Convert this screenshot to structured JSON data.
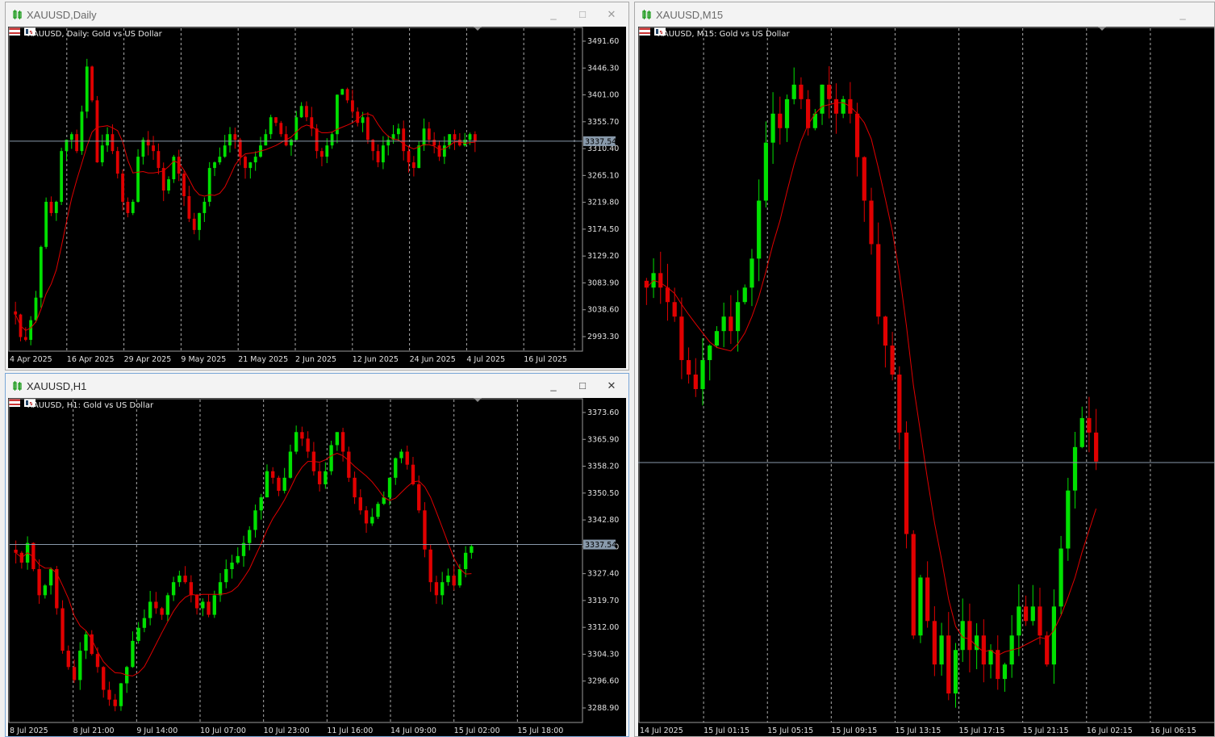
{
  "windows": [
    {
      "id": "daily",
      "title": "XAUUSD,Daily",
      "symbol_desc": "XAUUSD, Daily:  Gold vs US Dollar",
      "active": false,
      "controls": {
        "minimize": "_",
        "maximize": "□",
        "close": "✕"
      },
      "current_price": "3337.54",
      "price_axis": [
        "3491.60",
        "3446.30",
        "3401.00",
        "3355.70",
        "3310.40",
        "3265.10",
        "3219.80",
        "3174.50",
        "3129.20",
        "3083.90",
        "3038.60",
        "2993.30"
      ],
      "price_range": [
        2965,
        3515
      ],
      "time_axis": [
        "4 Apr 2025",
        "16 Apr 2025",
        "29 Apr 2025",
        "9 May 2025",
        "21 May 2025",
        "2 Jun 2025",
        "12 Jun 2025",
        "24 Jun 2025",
        "4 Jul 2025",
        "16 Jul 2025"
      ],
      "colors": {
        "up": "#00e000",
        "down": "#e00000",
        "ma": "#e00000",
        "grid": "#c8c8c8",
        "price_line": "#8899aa"
      }
    },
    {
      "id": "h1",
      "title": "XAUUSD,H1",
      "symbol_desc": "XAUUSD, H1:  Gold vs US Dollar",
      "active": true,
      "controls": {
        "minimize": "_",
        "maximize": "□",
        "close": "✕"
      },
      "current_price": "3337.54",
      "price_axis": [
        "3373.60",
        "3365.90",
        "3358.20",
        "3350.50",
        "3342.80",
        "3335.10",
        "3327.40",
        "3319.70",
        "3312.00",
        "3304.30",
        "3296.60",
        "3288.90"
      ],
      "price_range": [
        3283,
        3378
      ],
      "time_axis": [
        "8 Jul 2025",
        "8 Jul 21:00",
        "9 Jul 14:00",
        "10 Jul 07:00",
        "10 Jul 23:00",
        "11 Jul 16:00",
        "14 Jul 09:00",
        "15 Jul 02:00",
        "15 Jul 18:00"
      ],
      "colors": {
        "up": "#00e000",
        "down": "#e00000",
        "ma": "#e00000",
        "grid": "#c8c8c8",
        "price_line": "#8899aa"
      }
    },
    {
      "id": "m15",
      "title": "XAUUSD,M15",
      "symbol_desc": "XAUUSD, M15:  Gold vs US Dollar",
      "active": false,
      "controls": {
        "minimize": "_",
        "maximize": "□",
        "close": "✕"
      },
      "time_axis": [
        "14 Jul 2025",
        "15 Jul 01:15",
        "15 Jul 05:15",
        "15 Jul 09:15",
        "15 Jul 13:15",
        "15 Jul 17:15",
        "15 Jul 21:15",
        "16 Jul 02:15",
        "16 Jul 06:15"
      ],
      "price_range": [
        3320,
        3367
      ],
      "colors": {
        "up": "#00e000",
        "down": "#e00000",
        "ma": "#e00000",
        "grid": "#c8c8c8",
        "price_line": "#8899aa"
      }
    }
  ],
  "chart_data": [
    {
      "type": "candlestick",
      "title": "XAUUSD, Daily:  Gold vs US Dollar",
      "xlabel": "",
      "ylabel": "",
      "ylim": [
        2965,
        3515
      ],
      "current_price": 3337.54,
      "x": [
        "4 Apr 2025",
        "16 Apr 2025",
        "29 Apr 2025",
        "9 May 2025",
        "21 May 2025",
        "2 Jun 2025",
        "12 Jun 2025",
        "24 Jun 2025",
        "4 Jul 2025",
        "16 Jul 2025"
      ],
      "closes": [
        3030,
        2990,
        2985,
        3020,
        3060,
        3150,
        3230,
        3210,
        3230,
        3320,
        3340,
        3350,
        3320,
        3390,
        3470,
        3410,
        3300,
        3330,
        3350,
        3320,
        3280,
        3230,
        3210,
        3230,
        3310,
        3340,
        3330,
        3320,
        3290,
        3250,
        3270,
        3310,
        3280,
        3240,
        3200,
        3180,
        3210,
        3230,
        3290,
        3300,
        3310,
        3330,
        3350,
        3340,
        3310,
        3290,
        3300,
        3310,
        3330,
        3350,
        3380,
        3370,
        3350,
        3330,
        3340,
        3380,
        3400,
        3380,
        3360,
        3320,
        3310,
        3330,
        3350,
        3420,
        3430,
        3410,
        3390,
        3370,
        3380,
        3340,
        3320,
        3300,
        3330,
        3340,
        3350,
        3360,
        3320,
        3300,
        3290,
        3330,
        3360,
        3340,
        3330,
        3310,
        3330,
        3350,
        3340,
        3330,
        3340,
        3350,
        3337
      ],
      "moving_average_end": 3340,
      "grid": true
    },
    {
      "type": "candlestick",
      "title": "XAUUSD, H1:  Gold vs US Dollar",
      "xlabel": "",
      "ylabel": "",
      "ylim": [
        3283,
        3378
      ],
      "current_price": 3337.54,
      "x": [
        "8 Jul 2025",
        "8 Jul 21:00",
        "9 Jul 14:00",
        "10 Jul 07:00",
        "10 Jul 23:00",
        "11 Jul 16:00",
        "14 Jul 09:00",
        "15 Jul 02:00",
        "15 Jul 18:00"
      ],
      "closes": [
        3335,
        3332,
        3338,
        3330,
        3322,
        3325,
        3330,
        3318,
        3305,
        3300,
        3296,
        3305,
        3310,
        3304,
        3300,
        3293,
        3290,
        3288,
        3295,
        3300,
        3308,
        3312,
        3315,
        3320,
        3318,
        3316,
        3322,
        3326,
        3328,
        3326,
        3322,
        3318,
        3320,
        3316,
        3322,
        3326,
        3330,
        3332,
        3334,
        3338,
        3342,
        3348,
        3352,
        3360,
        3358,
        3354,
        3358,
        3366,
        3372,
        3370,
        3366,
        3360,
        3356,
        3360,
        3368,
        3372,
        3366,
        3358,
        3352,
        3348,
        3344,
        3346,
        3350,
        3352,
        3358,
        3364,
        3366,
        3362,
        3356,
        3348,
        3336,
        3326,
        3322,
        3326,
        3328,
        3325,
        3330,
        3335,
        3337
      ],
      "moving_average_end": 3337,
      "grid": true
    },
    {
      "type": "candlestick",
      "title": "XAUUSD, M15:  Gold vs US Dollar",
      "xlabel": "",
      "ylabel": "",
      "ylim": [
        3320,
        3367
      ],
      "x": [
        "14 Jul 2025",
        "15 Jul 01:15",
        "15 Jul 05:15",
        "15 Jul 09:15",
        "15 Jul 13:15",
        "15 Jul 17:15",
        "15 Jul 21:15",
        "16 Jul 02:15",
        "16 Jul 06:15"
      ],
      "closes": [
        3350,
        3351,
        3350,
        3349,
        3348,
        3345,
        3344,
        3343,
        3345,
        3346,
        3347,
        3348,
        3347,
        3349,
        3350,
        3352,
        3356,
        3360,
        3362,
        3361,
        3363,
        3364,
        3363,
        3361,
        3362,
        3364,
        3363,
        3362,
        3363,
        3362,
        3359,
        3356,
        3353,
        3348,
        3346,
        3344,
        3340,
        3333,
        3326,
        3330,
        3327,
        3324,
        3326,
        3322,
        3325,
        3327,
        3325,
        3326,
        3324,
        3325,
        3323,
        3324,
        3326,
        3328,
        3327,
        3328,
        3326,
        3324,
        3328,
        3332,
        3336,
        3339,
        3341,
        3340,
        3338
      ],
      "moving_average_end": 3339,
      "grid": true
    }
  ]
}
